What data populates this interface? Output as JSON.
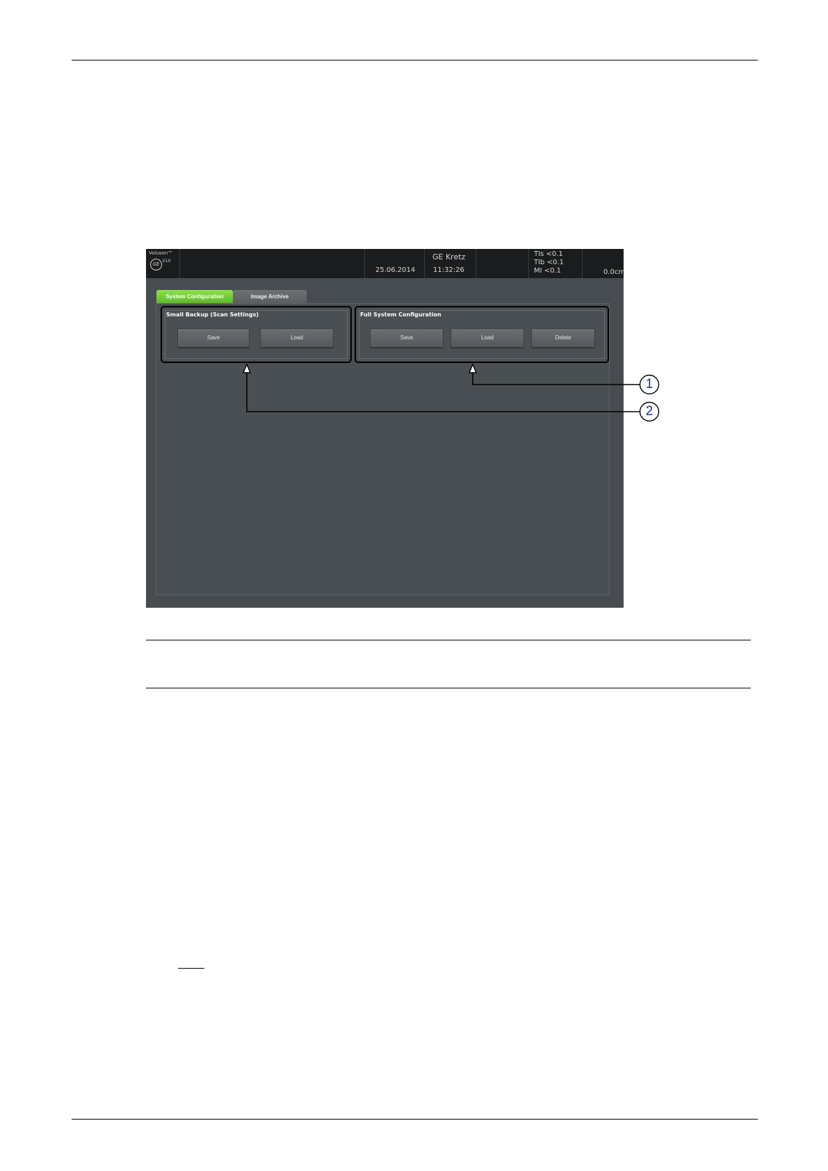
{
  "device": {
    "brand": "Voluson™",
    "logo": "GE",
    "model": "E10",
    "title": "GE Kretz",
    "date": "25.06.2014",
    "time": "11:32:26",
    "tis": "TIs <0.1",
    "tib": "TIb <0.1",
    "mi": "MI <0.1",
    "depth": "0.0cm"
  },
  "tabs": [
    {
      "label": "System Configuration",
      "active": true
    },
    {
      "label": "Image Archive",
      "active": false
    }
  ],
  "small_backup": {
    "title": "Small Backup (Scan Settings)",
    "save_label": "Save",
    "load_label": "Load"
  },
  "full_system": {
    "title": "Full System Configuration",
    "save_label": "Save",
    "load_label": "Load",
    "delete_label": "Delete"
  },
  "callouts": {
    "one": "1",
    "two": "2"
  },
  "colors": {
    "active_tab": "#6ccc35",
    "panel": "#474c50",
    "header": "#1a1c1e",
    "callout_number": "#1e2f8a"
  }
}
